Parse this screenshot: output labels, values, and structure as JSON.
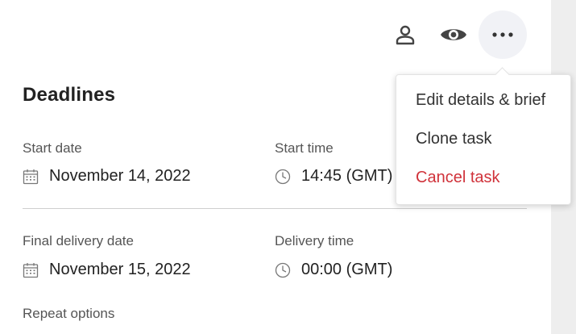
{
  "colors": {
    "danger": "#d0323a",
    "text": "#222222",
    "muted": "#555555",
    "more_button_bg": "#f1f2f6"
  },
  "toolbar": {
    "icons": [
      "person-icon",
      "eye-icon",
      "more-horizontal-icon"
    ]
  },
  "deadlines": {
    "title": "Deadlines",
    "start": {
      "date_label": "Start date",
      "date_value": "November 14, 2022",
      "time_label": "Start time",
      "time_value": "14:45 (GMT)"
    },
    "delivery": {
      "date_label": "Final delivery date",
      "date_value": "November 15, 2022",
      "time_label": "Delivery time",
      "time_value": "00:00 (GMT)"
    },
    "repeat_label": "Repeat options"
  },
  "menu": {
    "items": [
      {
        "label": "Edit details & brief"
      },
      {
        "label": "Clone task"
      },
      {
        "label": "Cancel task",
        "style": "danger"
      }
    ]
  }
}
